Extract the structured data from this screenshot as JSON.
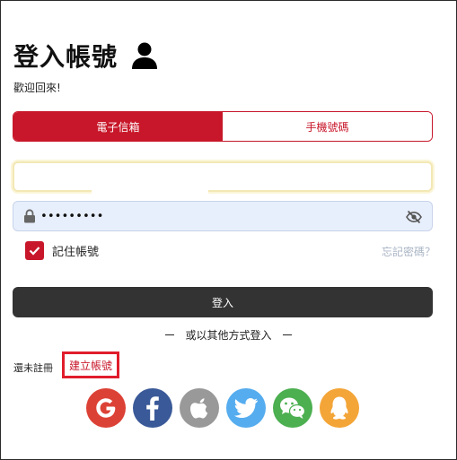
{
  "page": {
    "title": "登入帳號",
    "welcome": "歡迎回來!"
  },
  "tabs": [
    {
      "label": "電子信箱",
      "active": true
    },
    {
      "label": "手機號碼",
      "active": false
    }
  ],
  "email_field": {
    "value": "",
    "placeholder": ""
  },
  "password_field": {
    "value": "•••••••••"
  },
  "remember": {
    "label": "記住帳號",
    "checked": true
  },
  "forgot_password": "忘記密碼？",
  "login_button": "登入",
  "divider_text": "或以其他方式登入",
  "register": {
    "prompt": "還未註冊",
    "link": "建立帳號"
  },
  "social": [
    {
      "name": "google",
      "color": "#dc4136"
    },
    {
      "name": "facebook",
      "color": "#3a5998"
    },
    {
      "name": "apple",
      "color": "#999999"
    },
    {
      "name": "twitter",
      "color": "#55acee"
    },
    {
      "name": "wechat",
      "color": "#4caf50"
    },
    {
      "name": "qq",
      "color": "#f4a538"
    }
  ],
  "colors": {
    "accent": "#c8172a",
    "dark_button": "#333333",
    "password_bg": "#e8effc"
  }
}
